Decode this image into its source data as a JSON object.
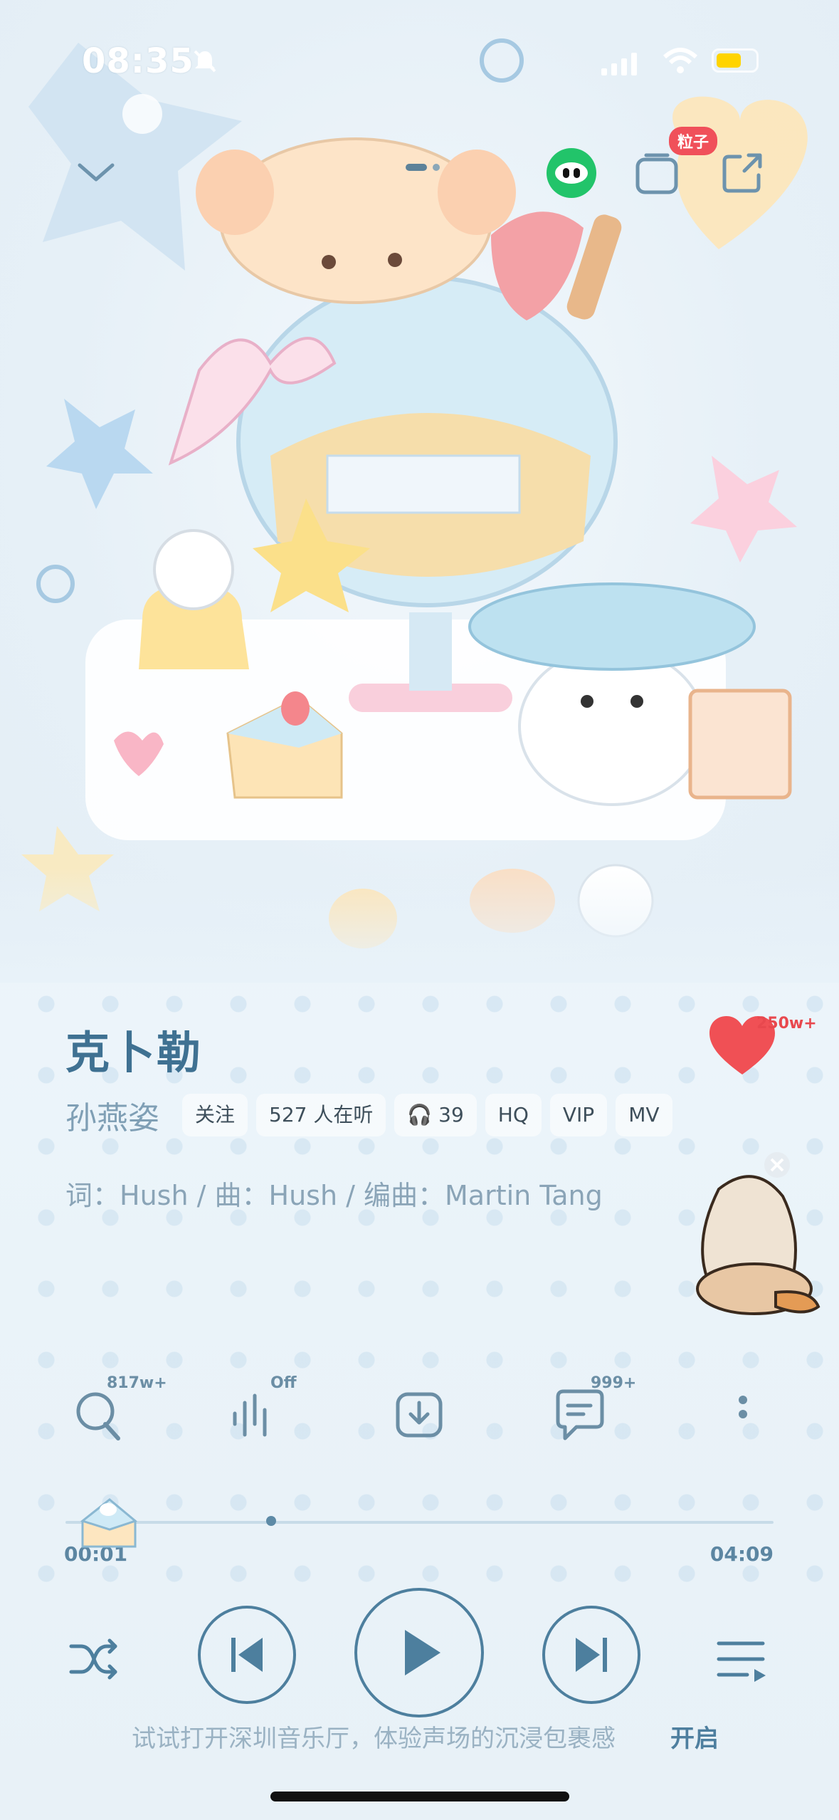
{
  "status_bar": {
    "time": "08:35"
  },
  "top": {
    "badge": "粒子"
  },
  "song": {
    "title": "克卜勒",
    "like_count": "250w+",
    "artist": "孙燕姿",
    "follow": "关注",
    "listeners": "527 人在听",
    "listen_count": "39",
    "quality": "HQ",
    "vip": "VIP",
    "mv": "MV",
    "credits": "词：Hush / 曲：Hush / 编曲：Martin Tang"
  },
  "actions": {
    "search_count": "817w+",
    "effect": "Off",
    "comments": "999+"
  },
  "player": {
    "elapsed": "00:01",
    "total": "04:09",
    "progress": 0.29
  },
  "hint": {
    "text": "试试打开深圳音乐厅，体验声场的沉浸包裹感",
    "action": "开启"
  },
  "colors": {
    "accent": "#4d7f9e",
    "like": "#f05055",
    "badge": "#f0505a"
  }
}
